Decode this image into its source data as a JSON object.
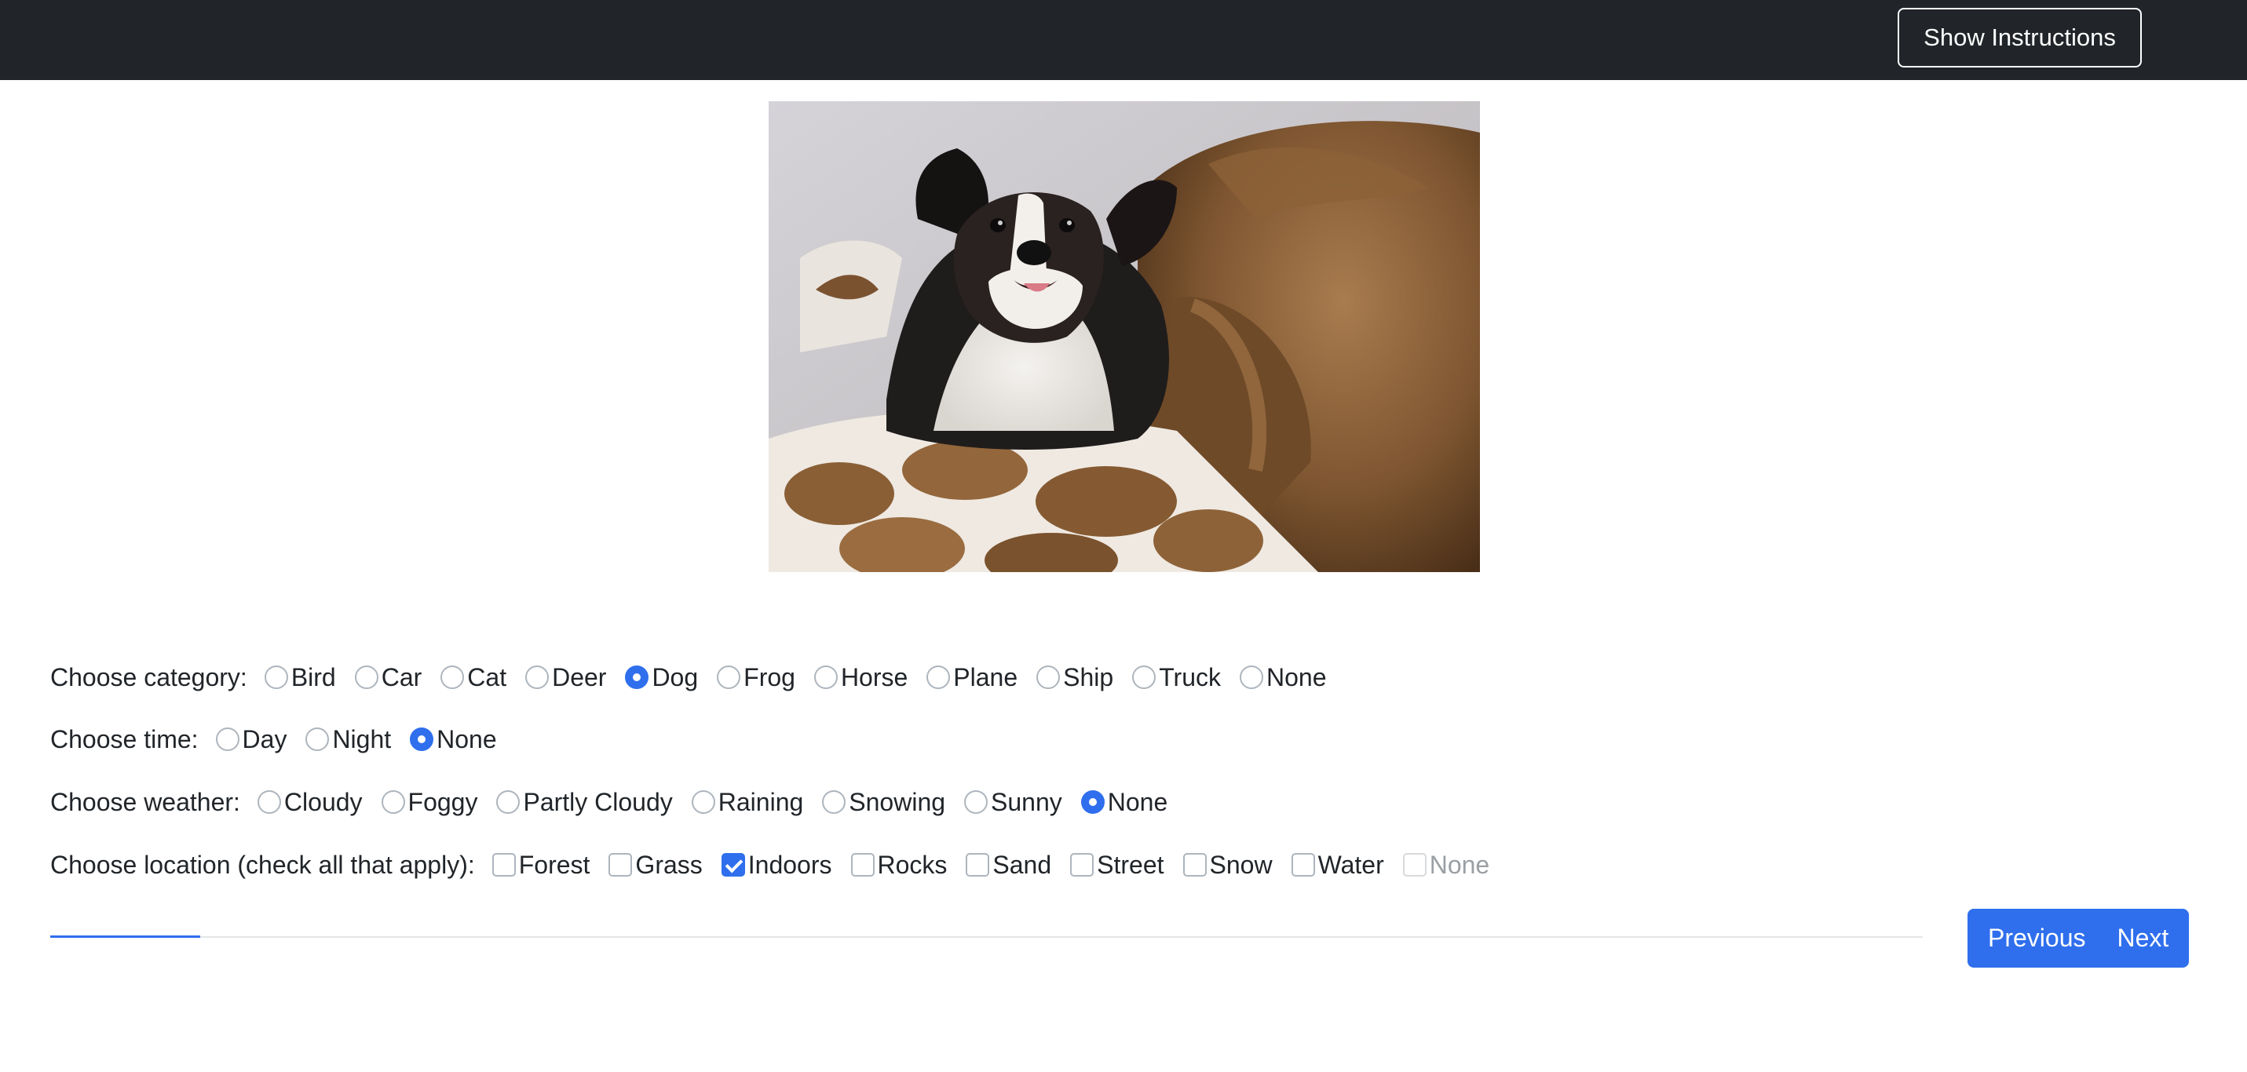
{
  "navbar": {
    "instructions_button": "Show Instructions"
  },
  "questions": {
    "category": {
      "label": "Choose category:",
      "options": [
        "Bird",
        "Car",
        "Cat",
        "Deer",
        "Dog",
        "Frog",
        "Horse",
        "Plane",
        "Ship",
        "Truck",
        "None"
      ],
      "selected": "Dog"
    },
    "time": {
      "label": "Choose time:",
      "options": [
        "Day",
        "Night",
        "None"
      ],
      "selected": "None"
    },
    "weather": {
      "label": "Choose weather:",
      "options": [
        "Cloudy",
        "Foggy",
        "Partly Cloudy",
        "Raining",
        "Snowing",
        "Sunny",
        "None"
      ],
      "selected": "None"
    },
    "location": {
      "label": "Choose location (check all that apply):",
      "options": [
        "Forest",
        "Grass",
        "Indoors",
        "Rocks",
        "Sand",
        "Street",
        "Snow",
        "Water",
        "None"
      ],
      "checked": [
        "Indoors"
      ],
      "disabled": [
        "None"
      ]
    }
  },
  "progress": {
    "fraction": 0.08
  },
  "nav": {
    "previous_label": "Previous",
    "next_label": "Next"
  },
  "colors": {
    "navbar_bg": "#212529",
    "accent": "#2f6fed"
  }
}
